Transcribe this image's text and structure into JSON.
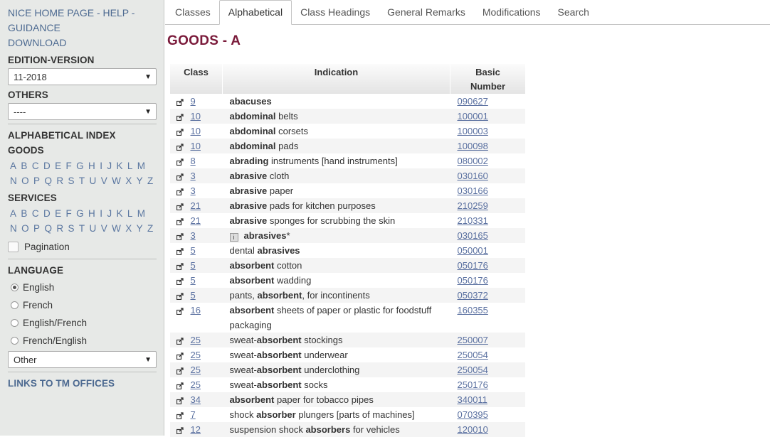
{
  "sidebar": {
    "nav": {
      "home": "NICE HOME PAGE",
      "sep": " - ",
      "help": "HELP",
      "sep2": " -",
      "guidance": "GUIDANCE",
      "download": "DOWNLOAD"
    },
    "edition_title": "EDITION-VERSION",
    "edition_value": "11-2018",
    "others_title": "OTHERS",
    "others_value": "----",
    "alpha_index_title": "ALPHABETICAL INDEX",
    "goods_title": "GOODS",
    "services_title": "SERVICES",
    "letters": [
      "A",
      "B",
      "C",
      "D",
      "E",
      "F",
      "G",
      "H",
      "I",
      "J",
      "K",
      "L",
      "M",
      "N",
      "O",
      "P",
      "Q",
      "R",
      "S",
      "T",
      "U",
      "V",
      "W",
      "X",
      "Y",
      "Z"
    ],
    "pagination_label": "Pagination",
    "language_title": "LANGUAGE",
    "languages": [
      "English",
      "French",
      "English/French",
      "French/English"
    ],
    "language_selected": "English",
    "other_value": "Other",
    "links_title": "LINKS TO TM OFFICES"
  },
  "tabs": [
    "Classes",
    "Alphabetical",
    "Class Headings",
    "General Remarks",
    "Modifications",
    "Search"
  ],
  "active_tab": "Alphabetical",
  "page_title": "GOODS - A",
  "table": {
    "headers": {
      "class": "Class",
      "indication": "Indication",
      "basic_number_1": "Basic",
      "basic_number_2": "Number"
    },
    "rows": [
      {
        "class": "9",
        "pre": "",
        "bold": "abacuses",
        "post": "",
        "number": "090627"
      },
      {
        "class": "10",
        "pre": "",
        "bold": "abdominal",
        "post": " belts",
        "number": "100001"
      },
      {
        "class": "10",
        "pre": "",
        "bold": "abdominal",
        "post": " corsets",
        "number": "100003"
      },
      {
        "class": "10",
        "pre": "",
        "bold": "abdominal",
        "post": " pads",
        "number": "100098"
      },
      {
        "class": "8",
        "pre": "",
        "bold": "abrading",
        "post": " instruments [hand instruments]",
        "number": "080002"
      },
      {
        "class": "3",
        "pre": "",
        "bold": "abrasive",
        "post": " cloth",
        "number": "030160"
      },
      {
        "class": "3",
        "pre": "",
        "bold": "abrasive",
        "post": " paper",
        "number": "030166"
      },
      {
        "class": "21",
        "pre": "",
        "bold": "abrasive",
        "post": " pads for kitchen purposes",
        "number": "210259"
      },
      {
        "class": "21",
        "pre": "",
        "bold": "abrasive",
        "post": " sponges for scrubbing the skin",
        "number": "210331"
      },
      {
        "class": "3",
        "pre": "",
        "bold": "abrasives",
        "post": "*",
        "number": "030165",
        "info": true
      },
      {
        "class": "5",
        "pre": "dental ",
        "bold": "abrasives",
        "post": "",
        "number": "050001"
      },
      {
        "class": "5",
        "pre": "",
        "bold": "absorbent",
        "post": " cotton",
        "number": "050176"
      },
      {
        "class": "5",
        "pre": "",
        "bold": "absorbent",
        "post": " wadding",
        "number": "050176"
      },
      {
        "class": "5",
        "pre": "pants, ",
        "bold": "absorbent",
        "post": ", for incontinents",
        "number": "050372"
      },
      {
        "class": "16",
        "pre": "",
        "bold": "absorbent",
        "post": " sheets of paper or plastic for foodstuff packaging",
        "number": "160355",
        "tall": true
      },
      {
        "class": "25",
        "pre": "sweat-",
        "bold": "absorbent",
        "post": " stockings",
        "number": "250007"
      },
      {
        "class": "25",
        "pre": "sweat-",
        "bold": "absorbent",
        "post": " underwear",
        "number": "250054"
      },
      {
        "class": "25",
        "pre": "sweat-",
        "bold": "absorbent",
        "post": " underclothing",
        "number": "250054"
      },
      {
        "class": "25",
        "pre": "sweat-",
        "bold": "absorbent",
        "post": " socks",
        "number": "250176"
      },
      {
        "class": "34",
        "pre": "",
        "bold": "absorbent",
        "post": " paper for tobacco pipes",
        "number": "340011"
      },
      {
        "class": "7",
        "pre": "shock ",
        "bold": "absorber",
        "post": " plungers [parts of machines]",
        "number": "070395"
      },
      {
        "class": "12",
        "pre": "suspension shock ",
        "bold": "absorbers",
        "post": " for vehicles",
        "number": "120010"
      }
    ]
  },
  "icons": {
    "row_icon": "external-link-icon",
    "info_icon": "info-icon",
    "caret": "chevron-down-icon"
  }
}
